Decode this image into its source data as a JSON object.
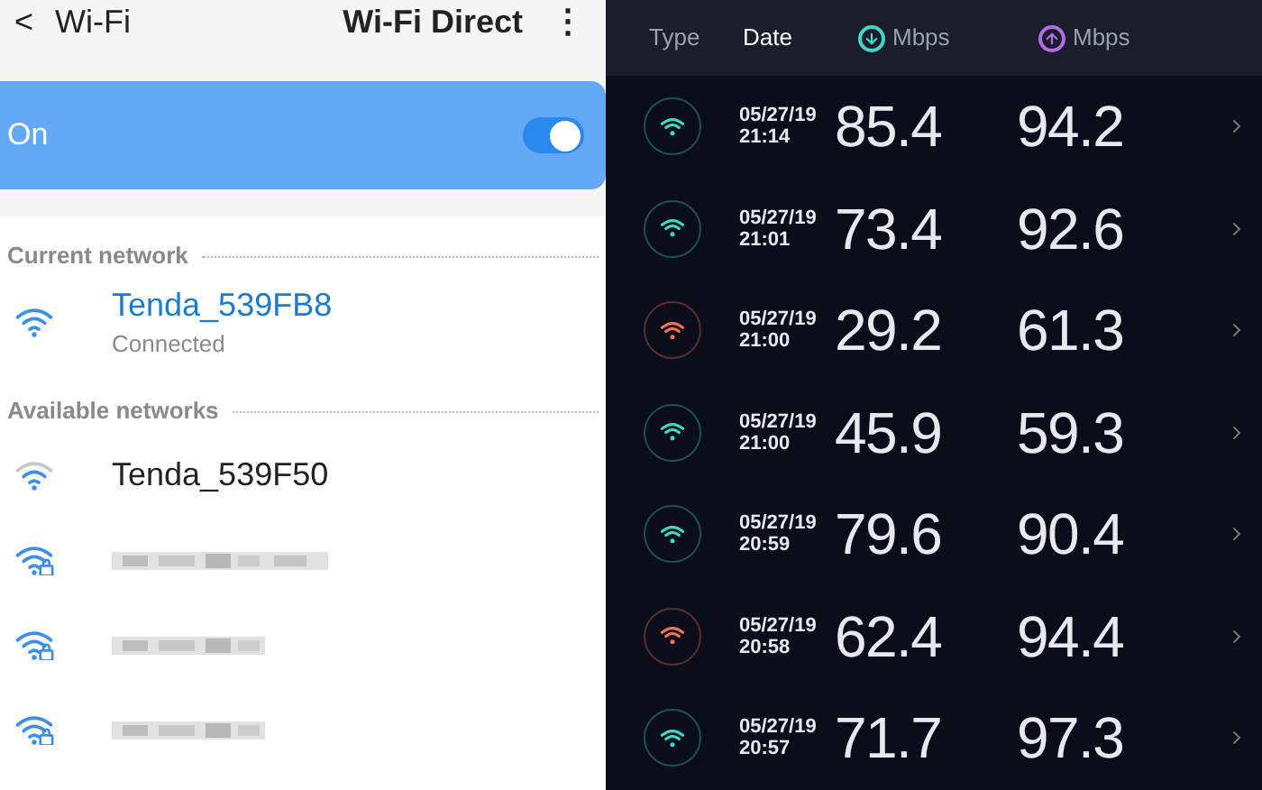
{
  "wifi_settings": {
    "back": "<",
    "title": "Wi-Fi",
    "action": "Wi-Fi Direct",
    "menu": "⋮",
    "master": {
      "label": "On",
      "on": true
    },
    "current_heading": "Current network",
    "current": {
      "name": "Tenda_539FB8",
      "status": "Connected"
    },
    "available_heading": "Available networks",
    "available": [
      {
        "kind": "named",
        "name": "Tenda_539F50",
        "secured": false
      },
      {
        "kind": "blurred",
        "secured": true
      },
      {
        "kind": "blurred",
        "secured": true
      },
      {
        "kind": "blurred",
        "secured": true
      }
    ]
  },
  "speed_results": {
    "columns": [
      {
        "kind": "text",
        "label": "Type",
        "selected": false
      },
      {
        "kind": "text",
        "label": "Date",
        "selected": true
      },
      {
        "kind": "download",
        "label": "Mbps",
        "selected": false
      },
      {
        "kind": "upload",
        "label": "Mbps",
        "selected": false
      }
    ],
    "rows": [
      {
        "color": "#3fd8c8",
        "date": "05/27/19",
        "time": "21:14",
        "download": "85.4",
        "upload": "94.2"
      },
      {
        "color": "#3fd8c8",
        "date": "05/27/19",
        "time": "21:01",
        "download": "73.4",
        "upload": "92.6"
      },
      {
        "color": "#f2734f",
        "date": "05/27/19",
        "time": "21:00",
        "download": "29.2",
        "upload": "61.3"
      },
      {
        "color": "#3fd8c8",
        "date": "05/27/19",
        "time": "21:00",
        "download": "45.9",
        "upload": "59.3"
      },
      {
        "color": "#3fd8c8",
        "date": "05/27/19",
        "time": "20:59",
        "download": "79.6",
        "upload": "90.4"
      },
      {
        "color": "#f2734f",
        "date": "05/27/19",
        "time": "20:58",
        "download": "62.4",
        "upload": "94.4"
      },
      {
        "color": "#3fd8c8",
        "date": "05/27/19",
        "time": "20:57",
        "download": "71.7",
        "upload": "97.3"
      }
    ]
  }
}
